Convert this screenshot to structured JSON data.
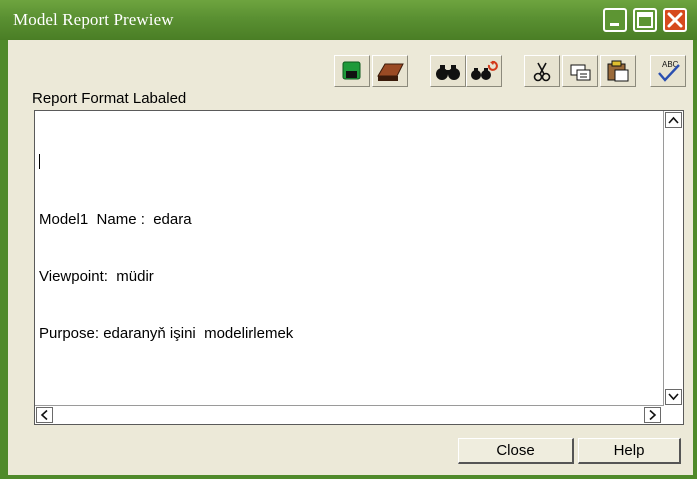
{
  "window": {
    "title": "Model Report Prewiew"
  },
  "title_buttons": [
    "minimize-icon",
    "maximize-icon",
    "close-icon"
  ],
  "toolbar": {
    "buttons": [
      "save-icon",
      "print-icon",
      "find-icon",
      "find-replace-icon",
      "cut-icon",
      "copy-icon",
      "paste-icon",
      "spellcheck-icon"
    ],
    "spellcheck_text": "ABC"
  },
  "report": {
    "label": "Report Format Labaled",
    "lines": [
      "Model1  Name :  edara",
      "Viewpoint:  müdir",
      "Purpose: edaranyň işini  modelirlemek"
    ]
  },
  "buttons": {
    "close": "Close",
    "help": "Help"
  },
  "colors": {
    "titlebar": "#5a9032",
    "close_button": "#d64a1e",
    "face": "#ece9d8"
  }
}
